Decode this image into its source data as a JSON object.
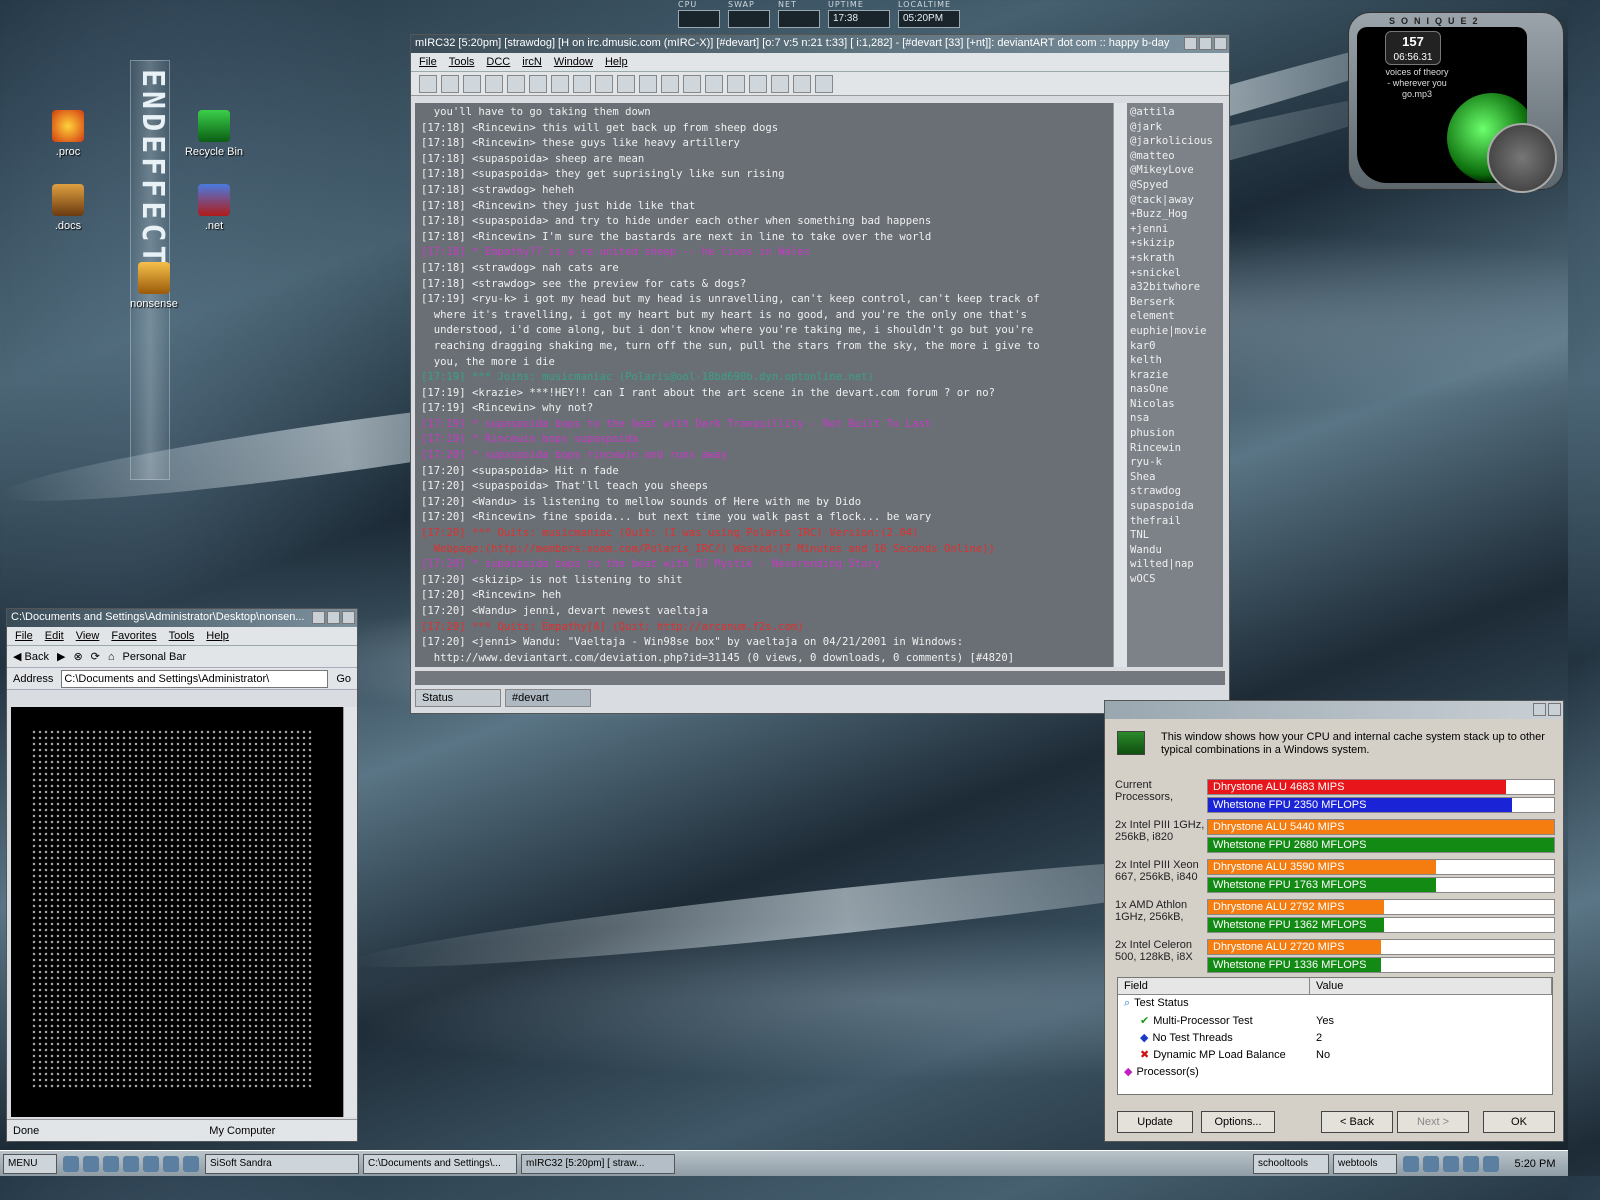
{
  "sysmon": [
    {
      "label": "CPU",
      "value": ""
    },
    {
      "label": "SWAP",
      "value": ""
    },
    {
      "label": "NET",
      "value": ""
    },
    {
      "label": "UPTIME",
      "value": "17:38"
    },
    {
      "label": "LOCALTIME",
      "value": "05:20PM"
    }
  ],
  "desktop_icons": [
    {
      "label": ".proc"
    },
    {
      "label": "Recycle Bin"
    },
    {
      "label": ".docs"
    },
    {
      "label": ".net"
    },
    {
      "label": "nonsense"
    }
  ],
  "logo_text": "ENDEFFECT",
  "soniqe": {
    "title": "SONIQUE2",
    "track_number": "157",
    "time": "06:56.31",
    "track_text": "voices of theory - wherever you go.mp3"
  },
  "mirc": {
    "title": "mIRC32 [5:20pm] [strawdog] [H on irc.dmusic.com (mIRC-X)] [#devart] [o:7 v:5 n:21 t:33] [ i:1,282] - [#devart [33] [+nt]]: deviantART dot com :: happy b-day",
    "menu": [
      "File",
      "Tools",
      "DCC",
      "ircN",
      "Window",
      "Help"
    ],
    "chat": [
      {
        "t": "  you'll have to go taking them down",
        "c": ""
      },
      {
        "t": "[17:18] <Rincewin> this will get back up from sheep dogs",
        "c": ""
      },
      {
        "t": "[17:18] <Rincewin> these guys like heavy artillery",
        "c": ""
      },
      {
        "t": "[17:18] <supaspoida> sheep are mean",
        "c": ""
      },
      {
        "t": "[17:18] <supaspoida> they get suprisingly like sun rising",
        "c": ""
      },
      {
        "t": "[17:18] <strawdog> heheh",
        "c": ""
      },
      {
        "t": "[17:18] <Rincewin> they just hide like that",
        "c": ""
      },
      {
        "t": "[17:18] <supaspoida> and try to hide under each other when something bad happens",
        "c": ""
      },
      {
        "t": "[17:18] <Rincewin> I'm sure the bastards are next in line to take over the world",
        "c": ""
      },
      {
        "t": "[17:18] * Empathy?? is a re united sheep -- he lives in Wales",
        "c": "c-act"
      },
      {
        "t": "[17:18] <strawdog> nah cats are",
        "c": ""
      },
      {
        "t": "[17:18] <strawdog> see the preview for cats & dogs?",
        "c": ""
      },
      {
        "t": "[17:19] <ryu-k> i got my head but my head is unravelling, can't keep control, can't keep track of",
        "c": ""
      },
      {
        "t": "  where it's travelling, i got my heart but my heart is no good, and you're the only one that's",
        "c": ""
      },
      {
        "t": "  understood, i'd come along, but i don't know where you're taking me, i shouldn't go but you're",
        "c": ""
      },
      {
        "t": "  reaching dragging shaking me, turn off the sun, pull the stars from the sky, the more i give to",
        "c": ""
      },
      {
        "t": "  you, the more i die",
        "c": ""
      },
      {
        "t": "[17:19] *** Joins: musicmaniac (Polaris@ool-18bd690b.dyn.optonline.net)",
        "c": "c-join"
      },
      {
        "t": "[17:19] <krazie> ***!HEY!! can I rant about the art scene in the devart.com forum ? or no?",
        "c": ""
      },
      {
        "t": "[17:19] <Rincewin> why not?",
        "c": ""
      },
      {
        "t": "[17:19] * supaspoida bops to the beat with Dark Tranquillity - Not Built To Last",
        "c": "c-act"
      },
      {
        "t": "[17:19] * Rincewin bops supaspoida",
        "c": "c-act"
      },
      {
        "t": "[17:20] * supaspoida bops rincewin and runs away",
        "c": "c-act"
      },
      {
        "t": "[17:20] <supaspoida> Hit n fade",
        "c": ""
      },
      {
        "t": "[17:20] <supaspoida> That'll teach you sheeps",
        "c": ""
      },
      {
        "t": "[17:20] <Wandu> is listening to mellow sounds of Here with me by Dido",
        "c": ""
      },
      {
        "t": "[17:20] <Rincewin> fine spoida... but next time you walk past a flock... be wary",
        "c": ""
      },
      {
        "t": "[17:20] *** Quits: musicmaniac (Quit: (I was using Polaris IRC) Version:(2.04)",
        "c": "c-quit"
      },
      {
        "t": "  Webpage:(http://members.xoom.com/Polaris_IRC/) Wasted:(7 Minutes and 16 Seconds Online))",
        "c": "c-quit"
      },
      {
        "t": "[17:20] * supaspoida bops to the beat with DJ Mystik - Neverending Story",
        "c": "c-act"
      },
      {
        "t": "[17:20] <skizip> is not listening to shit",
        "c": ""
      },
      {
        "t": "[17:20] <Rincewin> heh",
        "c": ""
      },
      {
        "t": "[17:20] <Wandu> jenni, devart newest vaeltaja",
        "c": ""
      },
      {
        "t": "[17:20] *** Quits: Empathy[A] (Quit: http://arcanum.f2s.com)",
        "c": "c-quit"
      },
      {
        "t": "[17:20] <jenni> Wandu: \"Vaeltaja - Win98se box\" by vaeltaja on 04/21/2001 in Windows:",
        "c": ""
      },
      {
        "t": "  http://www.deviantart.com/deviation.php?id=31145 (0 views, 0 downloads, 0 comments) [#4820]",
        "c": ""
      }
    ],
    "nicks": [
      "@attila",
      "@jark",
      "@jarkolicious",
      "@matteo",
      "@MikeyLove",
      "@Spyed",
      "@tack|away",
      "+Buzz_Hog",
      "+jenni",
      "+skizip",
      "+skrath",
      "+snickel",
      "a32bitwhore",
      "Berserk",
      "element",
      "euphie|movie",
      "kar0",
      "kelth",
      "krazie",
      "nasOne",
      "Nicolas",
      "nsa",
      "phusion",
      "Rincewin",
      "ryu-k",
      "Shea",
      "strawdog",
      "supaspoida",
      "thefrail",
      "TNL",
      "Wandu",
      "wilted|nap",
      "wOCS"
    ],
    "tabs": [
      "Status",
      "#devart"
    ]
  },
  "explorer": {
    "title": "C:\\Documents and Settings\\Administrator\\Desktop\\nonsen...",
    "menu": [
      "File",
      "Edit",
      "View",
      "Favorites",
      "Tools",
      "Help"
    ],
    "back_label": "Back",
    "personal_bar": "Personal Bar",
    "address_label": "Address",
    "address_value": "C:\\Documents and Settings\\Administrator\\",
    "go_label": "Go",
    "status_left": "Done",
    "status_right": "My Computer"
  },
  "sandra": {
    "description": "This window shows how your CPU and internal cache system stack up to other typical combinations in a Windows system.",
    "colors": {
      "current_alu": "#e8161a",
      "current_fpu": "#1a24d6",
      "ref_alu": "#f57d10",
      "ref_fpu": "#128a14"
    },
    "groups": [
      {
        "label": "Current Processors,",
        "alu": {
          "text": "Dhrystone ALU 4683 MIPS",
          "fraction": 0.86
        },
        "fpu": {
          "text": "Whetstone FPU 2350 MFLOPS",
          "fraction": 0.88
        },
        "current": true
      },
      {
        "label": "2x Intel PIII 1GHz, 256kB, i820",
        "alu": {
          "text": "Dhrystone ALU 5440 MIPS",
          "fraction": 1.0
        },
        "fpu": {
          "text": "Whetstone FPU 2680 MFLOPS",
          "fraction": 1.0
        },
        "current": false
      },
      {
        "label": "2x Intel PIII Xeon 667, 256kB, i840",
        "alu": {
          "text": "Dhrystone ALU 3590 MIPS",
          "fraction": 0.66
        },
        "fpu": {
          "text": "Whetstone FPU 1763 MFLOPS",
          "fraction": 0.66
        },
        "current": false
      },
      {
        "label": "1x AMD Athlon 1GHz, 256kB,",
        "alu": {
          "text": "Dhrystone ALU 2792 MIPS",
          "fraction": 0.51
        },
        "fpu": {
          "text": "Whetstone FPU 1362 MFLOPS",
          "fraction": 0.51
        },
        "current": false
      },
      {
        "label": "2x Intel Celeron 500, 128kB, i8X",
        "alu": {
          "text": "Dhrystone ALU 2720 MIPS",
          "fraction": 0.5
        },
        "fpu": {
          "text": "Whetstone FPU 1336 MFLOPS",
          "fraction": 0.5
        },
        "current": false
      }
    ],
    "table": {
      "headers": [
        "Field",
        "Value"
      ],
      "rows": [
        {
          "field": "Test Status",
          "value": "",
          "icon": "magnifier-icon",
          "indent": 0
        },
        {
          "field": "Multi-Processor Test",
          "value": "Yes",
          "icon": "checkmark-icon",
          "indent": 1
        },
        {
          "field": "No Test Threads",
          "value": "2",
          "icon": "info-diamond-icon",
          "indent": 1
        },
        {
          "field": "Dynamic MP Load Balance",
          "value": "No",
          "icon": "red-x-icon",
          "indent": 1
        },
        {
          "field": "Processor(s)",
          "value": "",
          "icon": "processor-diamond-icon",
          "indent": 0
        }
      ]
    },
    "buttons": {
      "update": "Update",
      "options": "Options...",
      "back": "< Back",
      "next": "Next >",
      "ok": "OK"
    }
  },
  "taskbar": {
    "start": "MENU",
    "tasks": [
      "SiSoft Sandra",
      "C:\\Documents and Settings\\...",
      "mIRC32 [5:20pm] [ straw..."
    ],
    "toolbars": [
      "schooltools",
      "webtools"
    ],
    "clock": "5:20 PM"
  }
}
